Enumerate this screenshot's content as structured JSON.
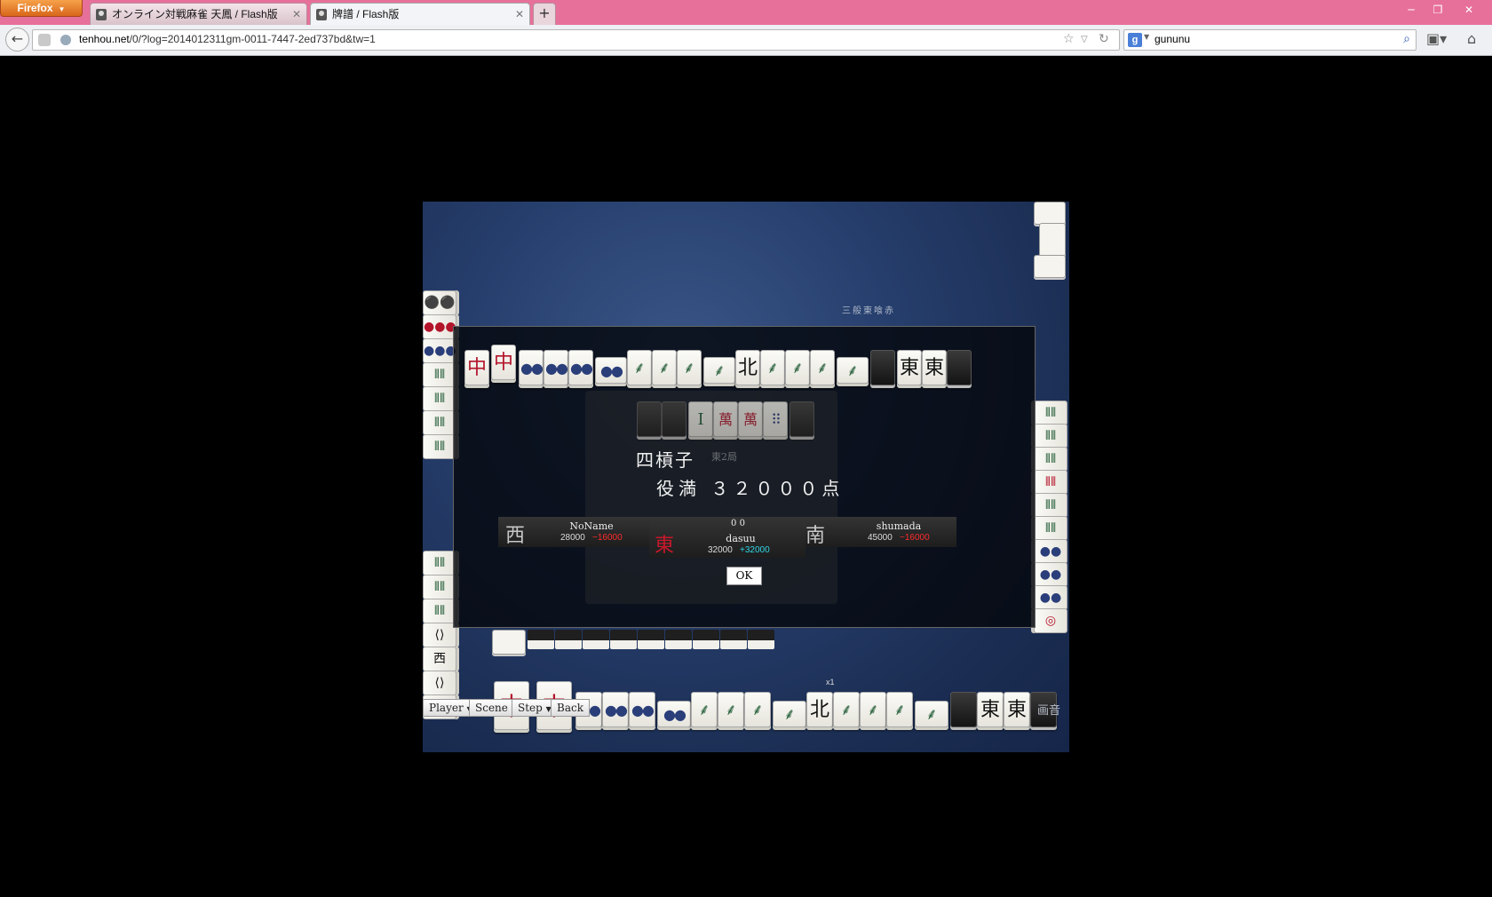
{
  "browser": {
    "menu_label": "Firefox",
    "tabs": [
      {
        "title": "オンライン対戦麻雀 天鳳 / Flash版"
      },
      {
        "title": "牌譜 / Flash版"
      }
    ],
    "new_tab": "+",
    "url_host": "tenhou.net",
    "url_path": "/0/?log=2014012311gm-0011-7447-2ed737bd&tw=1",
    "search_text": "gununu",
    "search_engine": "g"
  },
  "game": {
    "room_title": "三般東喰赤",
    "round": "東2局",
    "result": {
      "yaku": "四槓子",
      "score_text": "役満 ３２０００点"
    },
    "players": [
      {
        "wind": "西",
        "name": "NoName",
        "points": "28000",
        "delta": "−16000"
      },
      {
        "wind": "東",
        "name": "dasuu",
        "points": "32000",
        "delta": "+32000",
        "extra": "0 0"
      },
      {
        "wind": "南",
        "name": "shumada",
        "points": "45000",
        "delta": "−16000"
      }
    ],
    "ok_label": "OK",
    "controls": {
      "player": "Player",
      "scene": "Scene",
      "step": "Step",
      "back": "Back"
    },
    "bottom_right_label": "画音",
    "counter_label": "x1",
    "accent_colors": {
      "negative": "#ff2b2b",
      "positive": "#2fd6e8",
      "red_dragon": "#b3142a"
    }
  }
}
